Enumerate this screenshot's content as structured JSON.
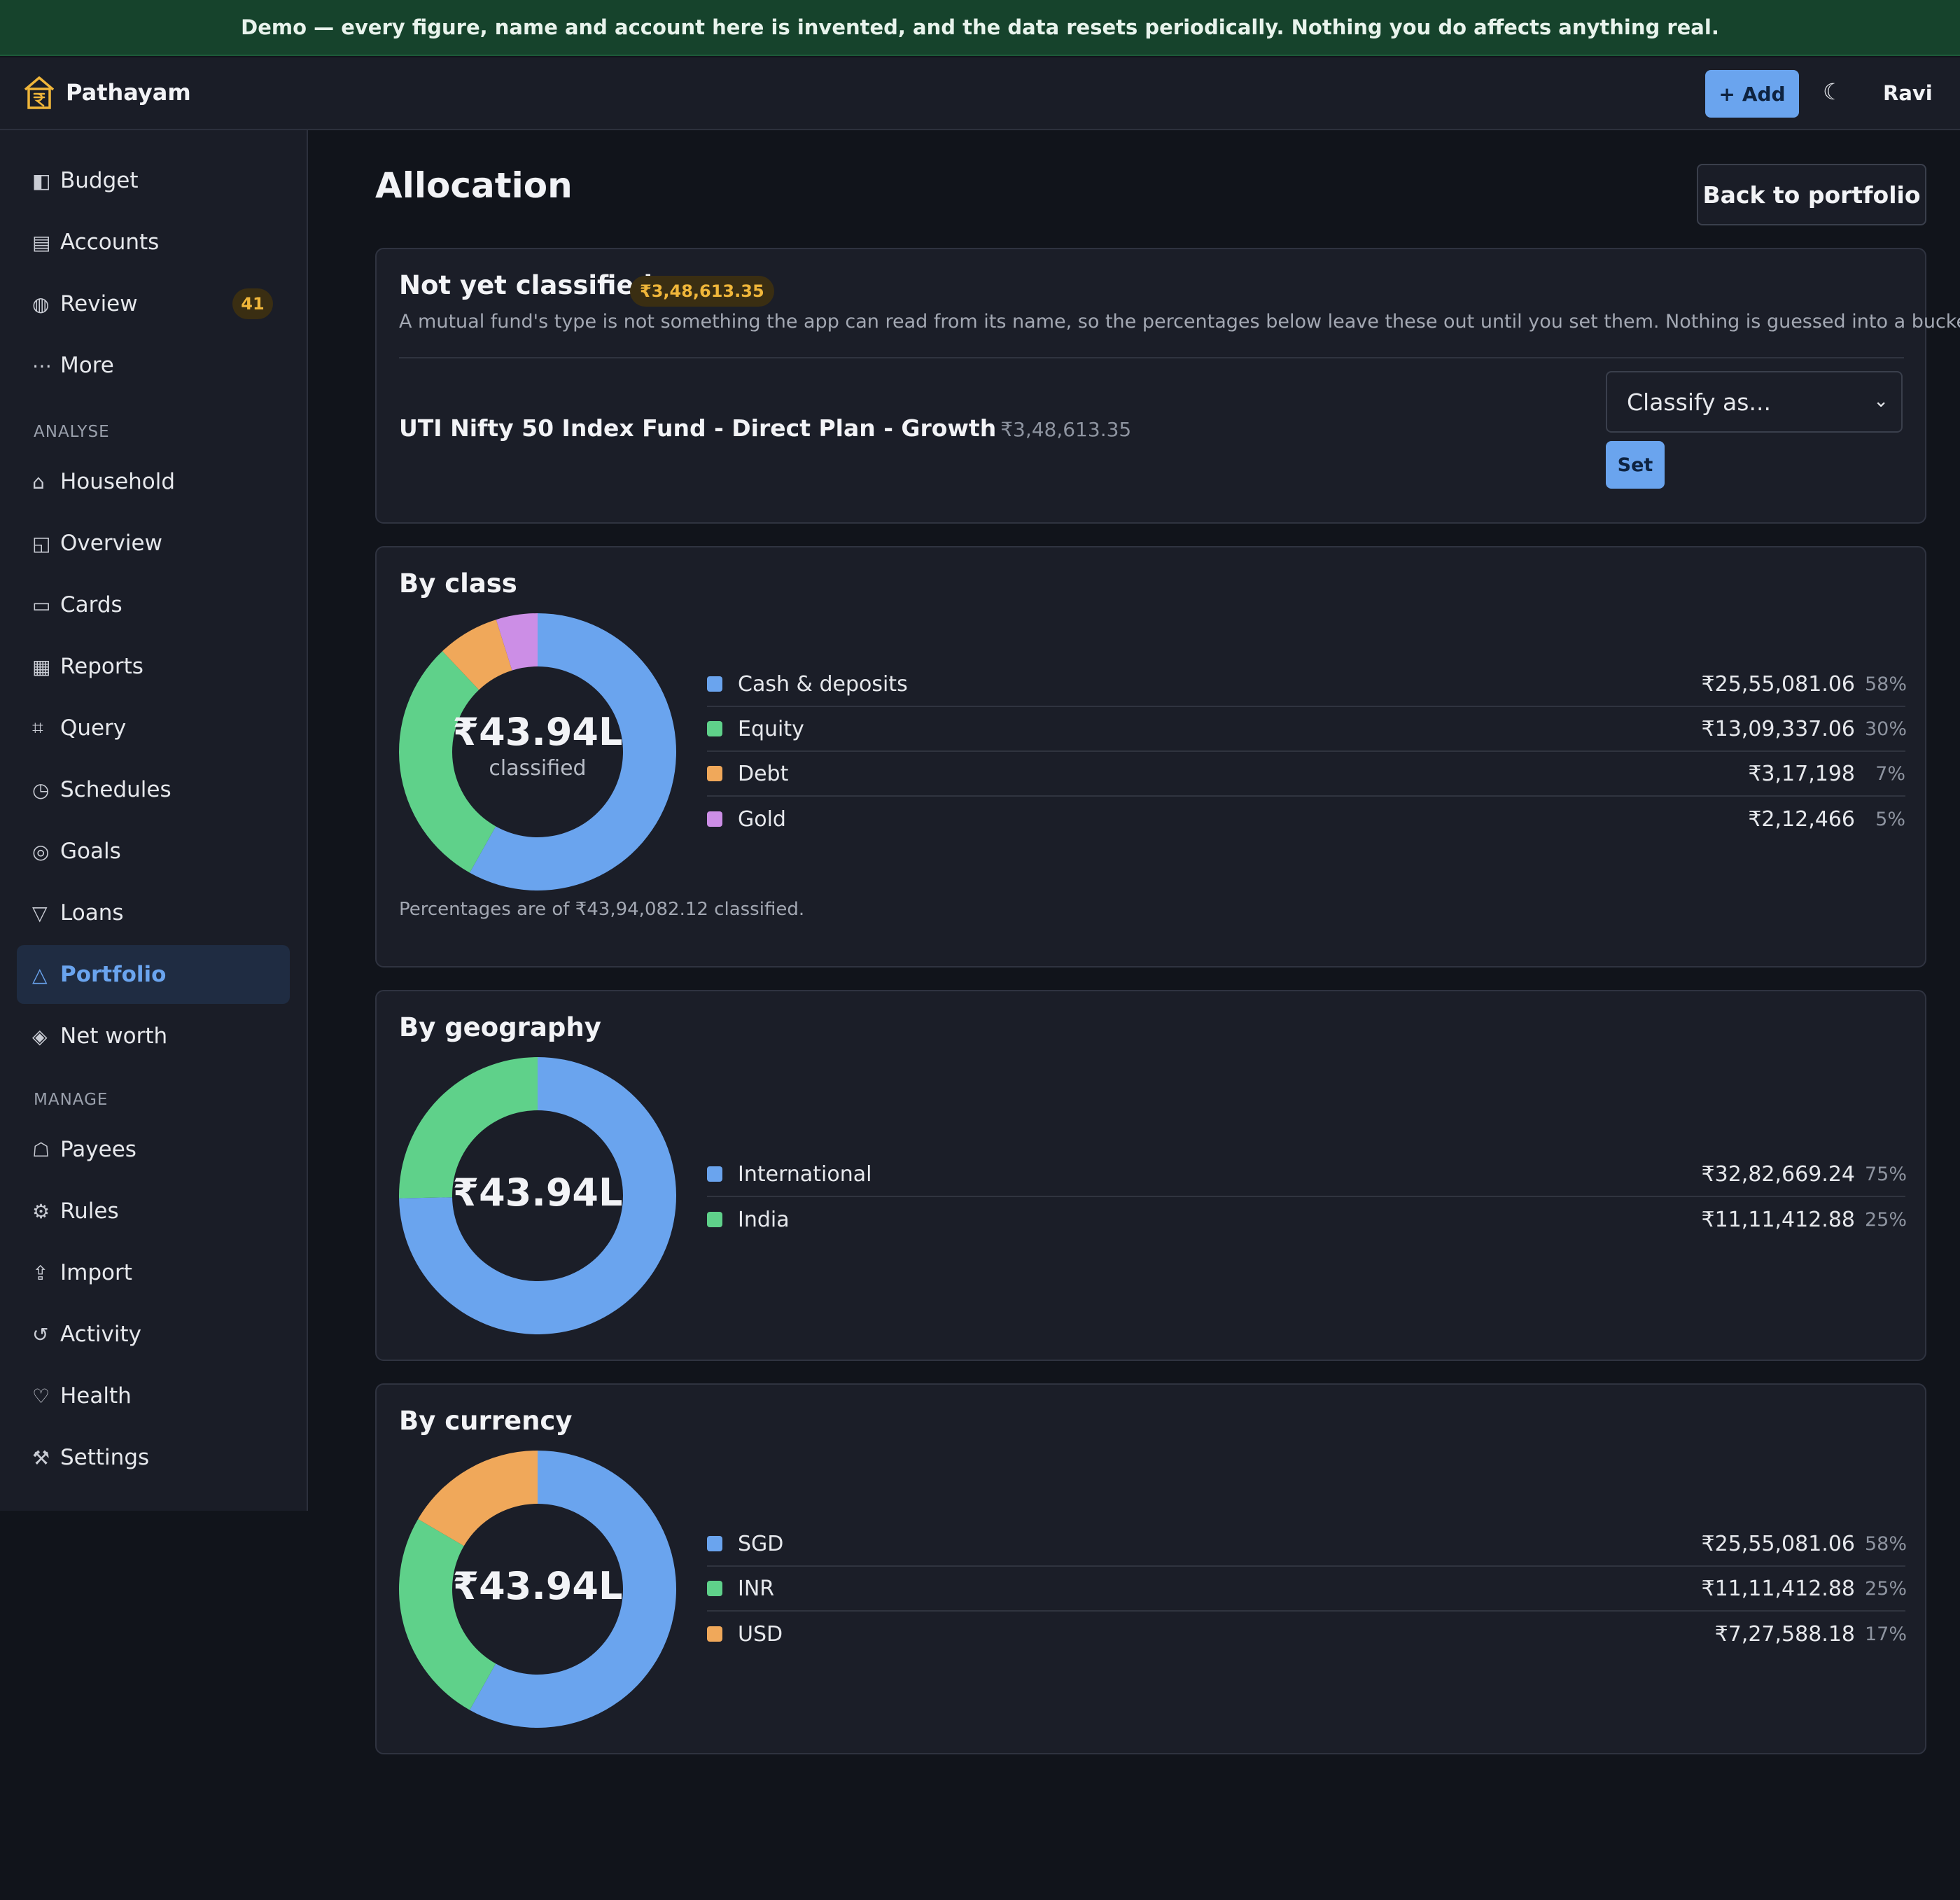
{
  "banner": {
    "text": "Demo — every figure, name and account here is invented, and the data resets periodically. Nothing you do affects anything real."
  },
  "topbar": {
    "brand": "Pathayam",
    "brand_icon": "house-rupee-icon",
    "add_label": "Add",
    "add_icon": "+",
    "theme_icon": "☾",
    "user": "Ravi"
  },
  "sidebar": {
    "items": [
      {
        "label": "Budget",
        "icon": "◧"
      },
      {
        "label": "Accounts",
        "icon": "▤"
      },
      {
        "label": "Review",
        "icon": "◍",
        "badge": "41"
      },
      {
        "label": "More",
        "icon": "⋯"
      }
    ],
    "analyse_label": "ANALYSE",
    "analyse": [
      {
        "label": "Household",
        "icon": "⌂"
      },
      {
        "label": "Overview",
        "icon": "◱"
      },
      {
        "label": "Cards",
        "icon": "▭"
      },
      {
        "label": "Reports",
        "icon": "▦"
      },
      {
        "label": "Query",
        "icon": "⌗"
      },
      {
        "label": "Schedules",
        "icon": "◷"
      },
      {
        "label": "Goals",
        "icon": "◎"
      },
      {
        "label": "Loans",
        "icon": "▽"
      },
      {
        "label": "Portfolio",
        "icon": "△"
      },
      {
        "label": "Net worth",
        "icon": "◈"
      }
    ],
    "manage_label": "MANAGE",
    "manage": [
      {
        "label": "Payees",
        "icon": "☖"
      },
      {
        "label": "Rules",
        "icon": "⚙"
      },
      {
        "label": "Import",
        "icon": "⇪"
      },
      {
        "label": "Activity",
        "icon": "↺"
      },
      {
        "label": "Health",
        "icon": "♡"
      },
      {
        "label": "Settings",
        "icon": "⚒"
      }
    ],
    "active": "Portfolio"
  },
  "page": {
    "title": "Allocation",
    "back_label": "Back to portfolio"
  },
  "unclassified": {
    "title": "Not yet classified",
    "total": "₹3,48,613.35",
    "description": "A mutual fund's type is not something the app can read from its name, so the percentages below leave these out until you set them. Nothing is guessed into a bucket.",
    "fund_name": "UTI Nifty 50 Index Fund - Direct Plan - Growth",
    "fund_amount": "₹3,48,613.35",
    "select_placeholder": "Classify as...",
    "set_label": "Set"
  },
  "colors": {
    "blue": "#6aa4ee",
    "green": "#5fd18a",
    "orange": "#f0a85a",
    "purple": "#cc8ee6",
    "accent": "#6aa4ee",
    "warning": "#f0b63a"
  },
  "by_class": {
    "title": "By class",
    "center_value": "₹43.94L",
    "center_label": "classified",
    "footnote": "Percentages are of ₹43,94,082.12 classified.",
    "rows": [
      {
        "label": "Cash & deposits",
        "value": "₹25,55,081.06",
        "pct": "58%"
      },
      {
        "label": "Equity",
        "value": "₹13,09,337.06",
        "pct": "30%"
      },
      {
        "label": "Debt",
        "value": "₹3,17,198",
        "pct": "7%"
      },
      {
        "label": "Gold",
        "value": "₹2,12,466",
        "pct": "5%"
      }
    ]
  },
  "by_geography": {
    "title": "By geography",
    "center_value": "₹43.94L",
    "rows": [
      {
        "label": "International",
        "value": "₹32,82,669.24",
        "pct": "75%"
      },
      {
        "label": "India",
        "value": "₹11,11,412.88",
        "pct": "25%"
      }
    ]
  },
  "by_currency": {
    "title": "By currency",
    "center_value": "₹43.94L",
    "rows": [
      {
        "label": "SGD",
        "value": "₹25,55,081.06",
        "pct": "58%"
      },
      {
        "label": "INR",
        "value": "₹11,11,412.88",
        "pct": "25%"
      },
      {
        "label": "USD",
        "value": "₹7,27,588.18",
        "pct": "17%"
      }
    ]
  },
  "chart_data": [
    {
      "type": "pie",
      "title": "By class",
      "categories": [
        "Cash & deposits",
        "Equity",
        "Debt",
        "Gold"
      ],
      "values": [
        2555081.06,
        1309337.06,
        317198,
        212466
      ],
      "colors": [
        "#6aa4ee",
        "#5fd18a",
        "#f0a85a",
        "#cc8ee6"
      ]
    },
    {
      "type": "pie",
      "title": "By geography",
      "categories": [
        "International",
        "India"
      ],
      "values": [
        3282669.24,
        1111412.88
      ],
      "colors": [
        "#6aa4ee",
        "#5fd18a"
      ]
    },
    {
      "type": "pie",
      "title": "By currency",
      "categories": [
        "SGD",
        "INR",
        "USD"
      ],
      "values": [
        2555081.06,
        1111412.88,
        727588.18
      ],
      "colors": [
        "#6aa4ee",
        "#5fd18a",
        "#f0a85a"
      ]
    }
  ]
}
